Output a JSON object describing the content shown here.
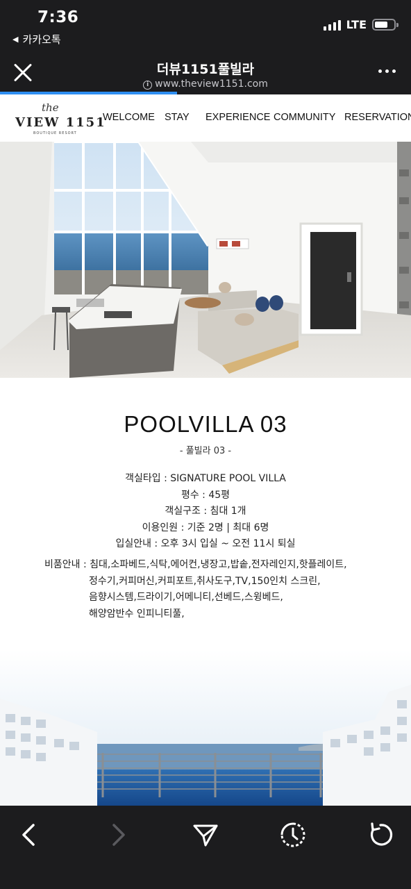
{
  "status_bar": {
    "time": "7:36",
    "back_app": "카카오톡",
    "network": "LTE",
    "battery_level": 0.7
  },
  "browser": {
    "title": "더뷰1151풀빌라",
    "url": "www.theview1151.com",
    "load_progress": 0.43
  },
  "site": {
    "logo": {
      "script": "the",
      "name": "VIEW 1151",
      "tagline": "BOUTIQUE RESORT"
    },
    "nav": [
      {
        "label": "WELCOME"
      },
      {
        "label": "STAY"
      },
      {
        "label": "EXPERIENCE"
      },
      {
        "label": "COMMUNITY"
      },
      {
        "label": "RESERVATION"
      }
    ]
  },
  "room": {
    "title": "POOLVILLA 03",
    "subtitle": "- 풀빌라 03 -",
    "specs": [
      "객실타입 : SIGNATURE POOL VILLA",
      "평수 : 45평",
      "객실구조 : 침대 1개",
      "이용인원 : 기준 2명 | 최대 6명",
      "입실안내 : 오후 3시 입실 ~ 오전 11시 퇴실"
    ],
    "amenities_label": "비품안내 : ",
    "amenities_lines": [
      "침대,소파베드,식탁,에어컨,냉장고,밥솥,전자레인지,핫플레이트,",
      "정수기,커피머신,커피포트,취사도구,TV,150인치 스크린,",
      "음향시스템,드라이기,어메니티,선베드,스윙베드,",
      "해양암반수 인피니티풀,"
    ]
  },
  "toolbar": {
    "back": "chevron-left-icon",
    "forward": "chevron-right-icon",
    "share": "send-icon",
    "history": "history-icon",
    "reload": "reload-icon"
  },
  "colors": {
    "chrome_bg": "#1c1c1e",
    "progress": "#2f8ff2",
    "page_bg": "#ffffff"
  }
}
